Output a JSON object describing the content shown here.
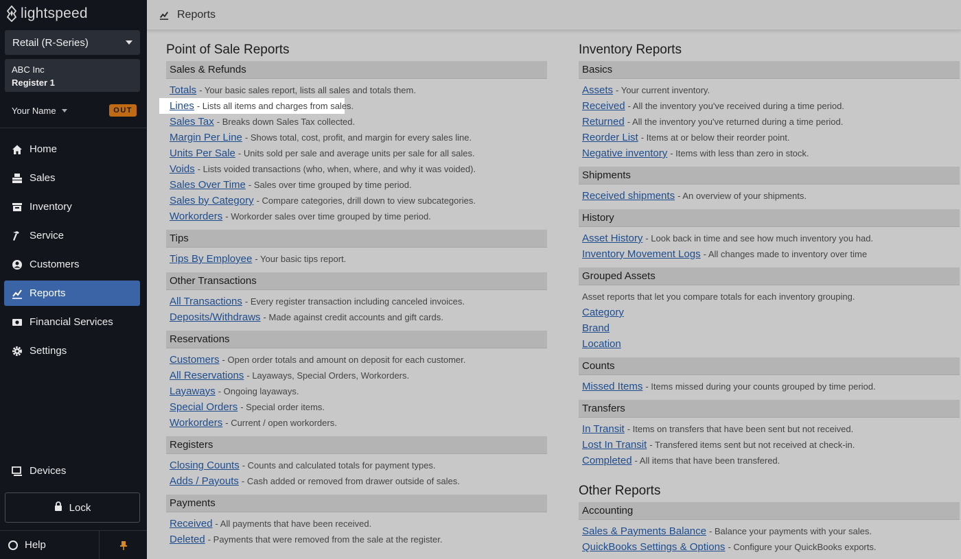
{
  "app": {
    "logo_text": "lightspeed"
  },
  "sidebar": {
    "product": "Retail (R-Series)",
    "company": "ABC Inc",
    "register": "Register 1",
    "user_name": "Your Name",
    "status_badge": "OUT",
    "nav": [
      {
        "label": "Home",
        "icon": "home-icon"
      },
      {
        "label": "Sales",
        "icon": "sales-icon"
      },
      {
        "label": "Inventory",
        "icon": "inventory-icon"
      },
      {
        "label": "Service",
        "icon": "hammer-icon"
      },
      {
        "label": "Customers",
        "icon": "customer-icon"
      },
      {
        "label": "Reports",
        "icon": "chart-icon",
        "active": true
      },
      {
        "label": "Financial Services",
        "icon": "money-icon"
      },
      {
        "label": "Settings",
        "icon": "gear-icon"
      }
    ],
    "devices": "Devices",
    "lock": "Lock",
    "help": "Help"
  },
  "header": {
    "title": "Reports"
  },
  "pos_reports": {
    "title": "Point of Sale Reports",
    "groups": [
      {
        "name": "Sales & Refunds",
        "items": [
          {
            "link": "Totals",
            "desc": "- Your basic sales report, lists all sales and totals them."
          },
          {
            "link": "Lines",
            "desc": "- Lists all items and charges from sales."
          },
          {
            "link": "Sales Tax",
            "desc": "- Breaks down Sales Tax collected."
          },
          {
            "link": "Margin Per Line",
            "desc": "- Shows total, cost, profit, and margin for every sales line."
          },
          {
            "link": "Units Per Sale",
            "desc": "- Units sold per sale and average units per sale for all sales."
          },
          {
            "link": "Voids",
            "desc": "- Lists voided transactions (who, when, where, and why it was voided)."
          },
          {
            "link": "Sales Over Time",
            "desc": "- Sales over time grouped by time period."
          },
          {
            "link": "Sales by Category",
            "desc": "- Compare categories, drill down to view subcategories."
          },
          {
            "link": "Workorders",
            "desc": "- Workorder sales over time grouped by time period."
          }
        ]
      },
      {
        "name": "Tips",
        "items": [
          {
            "link": "Tips By Employee",
            "desc": "- Your basic tips report."
          }
        ]
      },
      {
        "name": "Other Transactions",
        "items": [
          {
            "link": "All Transactions",
            "desc": "- Every register transaction including canceled invoices."
          },
          {
            "link": "Deposits/Withdraws",
            "desc": "- Made against credit accounts and gift cards."
          }
        ]
      },
      {
        "name": "Reservations",
        "items": [
          {
            "link": "Customers",
            "desc": "- Open order totals and amount on deposit for each customer."
          },
          {
            "link": "All Reservations",
            "desc": "- Layaways, Special Orders, Workorders."
          },
          {
            "link": "Layaways",
            "desc": "- Ongoing layaways."
          },
          {
            "link": "Special Orders",
            "desc": "- Special order items."
          },
          {
            "link": "Workorders",
            "desc": "- Current / open workorders."
          }
        ]
      },
      {
        "name": "Registers",
        "items": [
          {
            "link": "Closing Counts",
            "desc": "- Counts and calculated totals for payment types."
          },
          {
            "link": "Adds / Payouts",
            "desc": "- Cash added or removed from drawer outside of sales."
          }
        ]
      },
      {
        "name": "Payments",
        "items": [
          {
            "link": "Received",
            "desc": "- All payments that have been received."
          },
          {
            "link": "Deleted",
            "desc": "- Payments that were removed from the sale at the register."
          }
        ]
      }
    ]
  },
  "inventory_reports": {
    "title": "Inventory Reports",
    "groups": [
      {
        "name": "Basics",
        "items": [
          {
            "link": "Assets",
            "desc": "- Your current inventory."
          },
          {
            "link": "Received",
            "desc": "- All the inventory you've received during a time period."
          },
          {
            "link": "Returned",
            "desc": "- All the inventory you've returned during a time period."
          },
          {
            "link": "Reorder List",
            "desc": "- Items at or below their reorder point."
          },
          {
            "link": "Negative inventory",
            "desc": "- Items with less than zero in stock."
          }
        ]
      },
      {
        "name": "Shipments",
        "items": [
          {
            "link": "Received shipments",
            "desc": "- An overview of your shipments."
          }
        ]
      },
      {
        "name": "History",
        "items": [
          {
            "link": "Asset History",
            "desc": "- Look back in time and see how much inventory you had."
          },
          {
            "link": "Inventory Movement Logs",
            "desc": "- All changes made to inventory over time"
          }
        ]
      },
      {
        "name": "Grouped Assets",
        "description": "Asset reports that let you compare totals for each inventory grouping.",
        "items": [
          {
            "link": "Category",
            "desc": ""
          },
          {
            "link": "Brand",
            "desc": ""
          },
          {
            "link": "Location",
            "desc": ""
          }
        ]
      },
      {
        "name": "Counts",
        "items": [
          {
            "link": "Missed Items",
            "desc": "- Items missed during your counts grouped by time period."
          }
        ]
      },
      {
        "name": "Transfers",
        "items": [
          {
            "link": "In Transit",
            "desc": "- Items on transfers that have been sent but not received."
          },
          {
            "link": "Lost In Transit",
            "desc": "- Transfered items sent but not received at check-in."
          },
          {
            "link": "Completed",
            "desc": "- All items that have been transfered."
          }
        ]
      }
    ]
  },
  "other_reports": {
    "title": "Other Reports",
    "groups": [
      {
        "name": "Accounting",
        "items": [
          {
            "link": "Sales & Payments Balance",
            "desc": "- Balance your payments with your sales."
          },
          {
            "link": "QuickBooks Settings & Options",
            "desc": "- Configure your QuickBooks exports."
          }
        ]
      }
    ]
  },
  "highlight": {
    "section": "pos_reports",
    "group": 0,
    "item": 1
  },
  "colors": {
    "sidebar_bg": "#12151c",
    "active_nav": "#3a64a6",
    "link": "#1d4d8f",
    "badge": "#c06a14"
  }
}
